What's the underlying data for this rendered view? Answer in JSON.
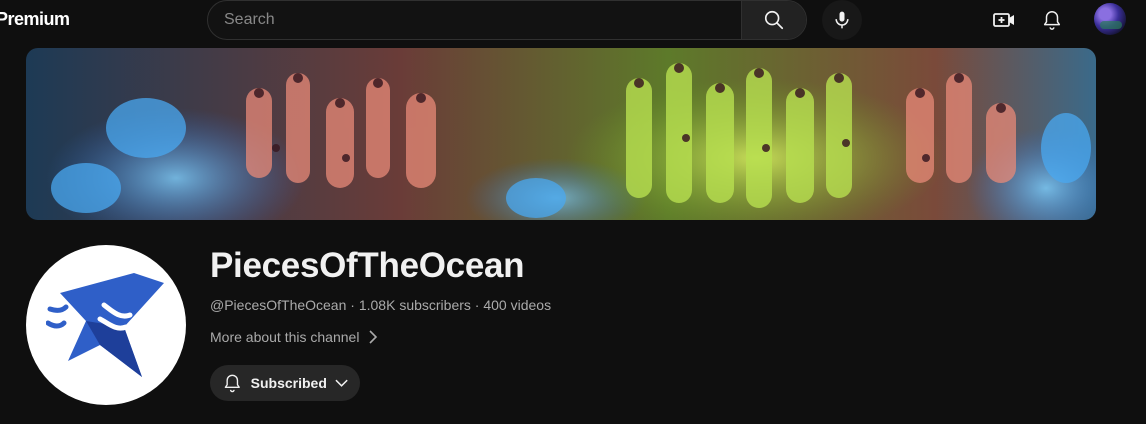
{
  "header": {
    "brand": "Premium",
    "search": {
      "placeholder": "Search"
    },
    "icons": [
      "search-icon",
      "mic-icon",
      "create-icon",
      "bell-icon",
      "avatar"
    ]
  },
  "banner": {
    "subject": "coral-reef-closeup"
  },
  "channel": {
    "name": "PiecesOfTheOcean",
    "handle": "@PiecesOfTheOcean",
    "subscribers": "1.08K subscribers",
    "videos": "400 videos",
    "separator": "·",
    "more_about": "More about this channel",
    "subscribe_label": "Subscribed"
  },
  "colors": {
    "background": "#0f0f0f",
    "text_primary": "#f1f1f1",
    "text_secondary": "#aaaaaa",
    "button_bg": "#272727",
    "logo_blue": "#2f5fc8"
  }
}
